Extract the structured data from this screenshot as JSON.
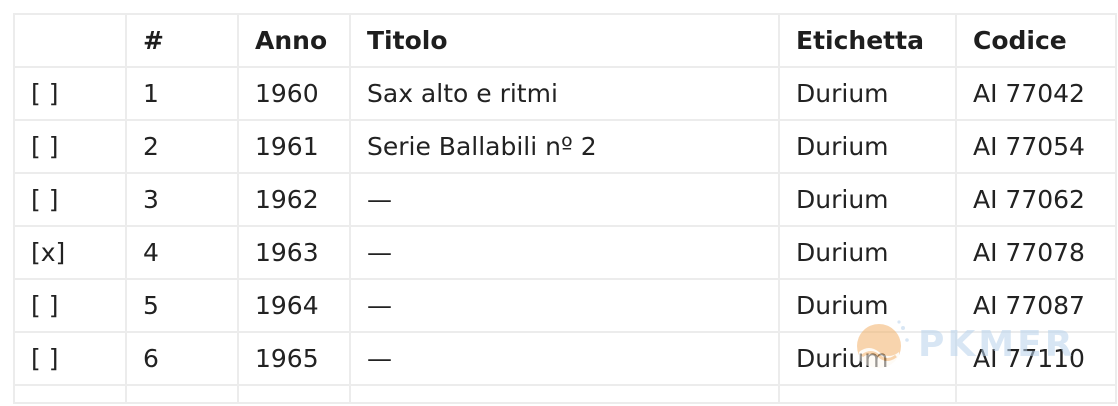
{
  "table": {
    "headers": [
      "",
      "#",
      "Anno",
      "Titolo",
      "Etichetta",
      "Codice"
    ],
    "rows": [
      [
        "[ ]",
        "1",
        "1960",
        "Sax alto e ritmi",
        "Durium",
        "AI 77042"
      ],
      [
        "[ ]",
        "2",
        "1961",
        "Serie Ballabili nº 2",
        "Durium",
        "AI 77054"
      ],
      [
        "[ ]",
        "3",
        "1962",
        "—",
        "Durium",
        "AI 77062"
      ],
      [
        "[x]",
        "4",
        "1963",
        "—",
        "Durium",
        "AI 77078"
      ],
      [
        "[ ]",
        "5",
        "1964",
        "—",
        "Durium",
        "AI 77087"
      ],
      [
        "[ ]",
        "6",
        "1965",
        "—",
        "Durium",
        "AI 77110"
      ]
    ]
  },
  "watermark": {
    "text": "PKMER",
    "icon": "pkmer-logo-icon"
  },
  "colors": {
    "border": "#ececec",
    "text": "#222222",
    "watermark_text": "#b9d3ec",
    "logo_orange": "#f3b26b"
  }
}
